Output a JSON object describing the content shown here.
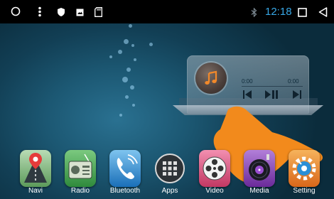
{
  "status_bar": {
    "time": "12:18",
    "icons": [
      "home-circle-icon",
      "more-vert-icon",
      "shield-icon",
      "image-icon",
      "sd-card-icon",
      "bluetooth-icon",
      "recent-apps-icon",
      "back-icon"
    ]
  },
  "music_player": {
    "elapsed": "0:00",
    "duration": "0:00",
    "controls": [
      "previous-icon",
      "play-pause-icon",
      "next-icon"
    ]
  },
  "apps": [
    {
      "label": "Navi",
      "icon": "navi-icon",
      "color": "#6fae6a"
    },
    {
      "label": "Radio",
      "icon": "radio-icon",
      "color": "#3d9a4a"
    },
    {
      "label": "Bluetooth",
      "icon": "phone-icon",
      "color": "#1e86d0"
    },
    {
      "label": "Apps",
      "icon": "apps-grid-icon",
      "color": "#3a3f45"
    },
    {
      "label": "Video",
      "icon": "film-reel-icon",
      "color": "#d94a70"
    },
    {
      "label": "Media",
      "icon": "media-disc-icon",
      "color": "#8a3fb5"
    },
    {
      "label": "Setting",
      "icon": "settings-gear-icon",
      "color": "#e8812a"
    }
  ],
  "colors": {
    "accent_time": "#38a8e6",
    "hand_overlay": "#f28a1c"
  }
}
